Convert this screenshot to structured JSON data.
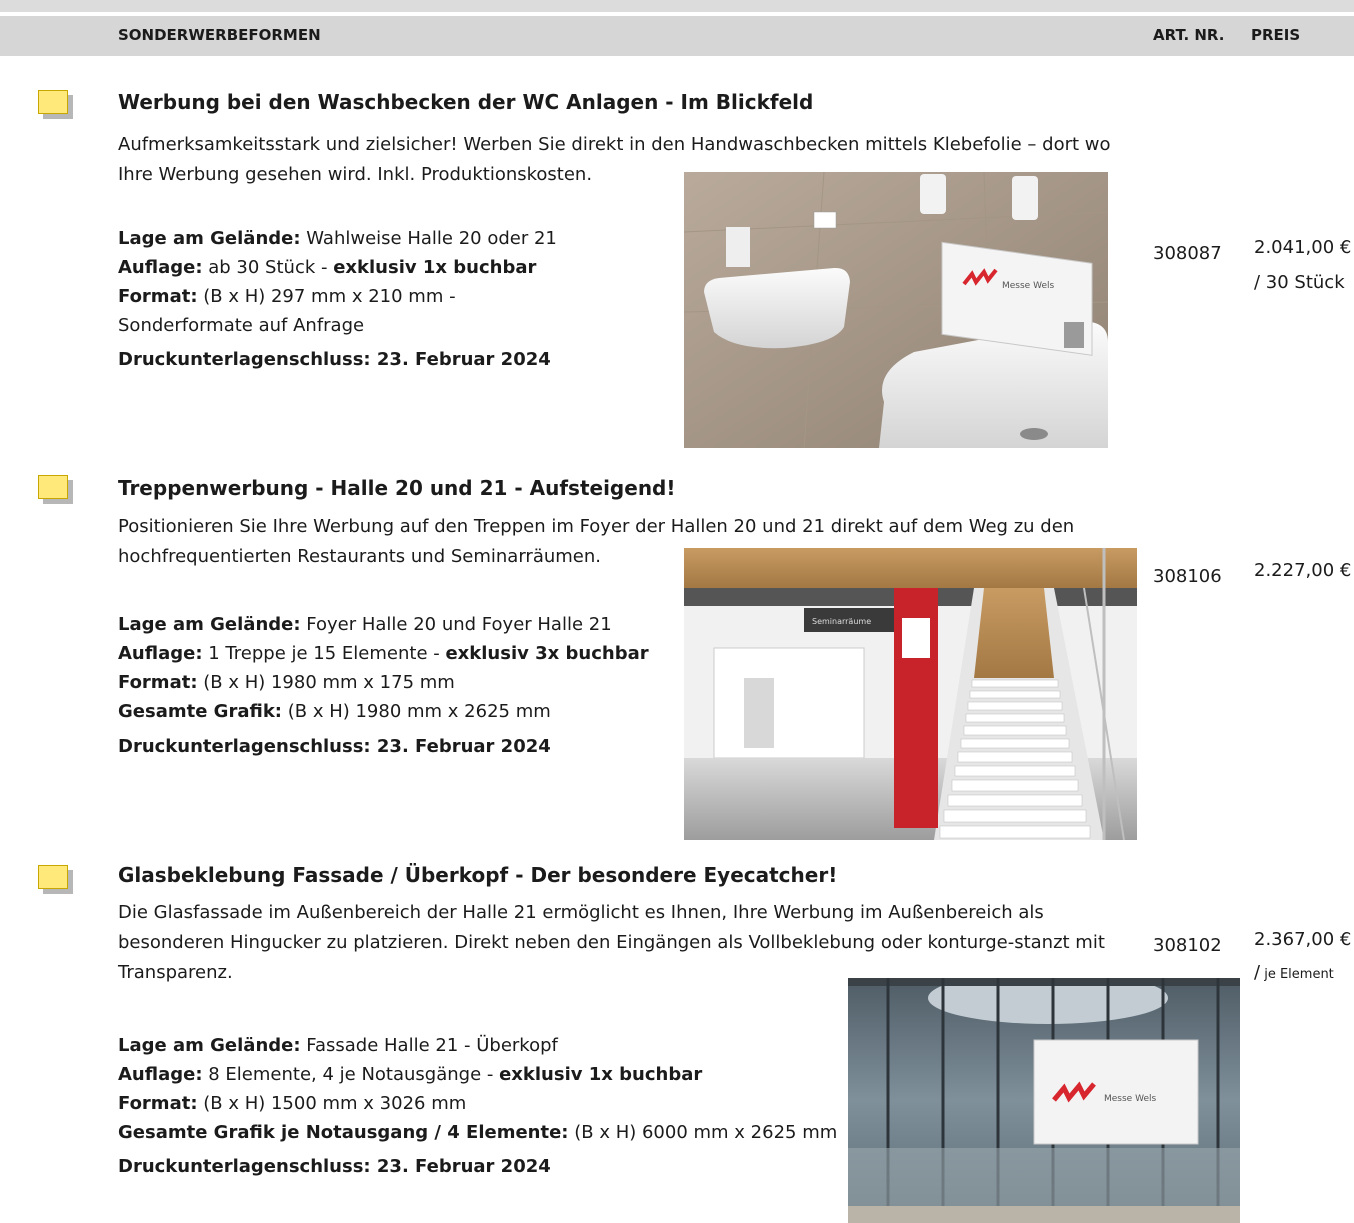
{
  "header": {
    "section": "SONDERWERBEFORMEN",
    "art_nr": "ART. NR.",
    "preis": "PREIS"
  },
  "items": [
    {
      "title": "Werbung bei den Waschbecken der WC Anlagen - Im Blickfeld",
      "desc": "Aufmerksamkeitsstark und zielsicher! Werben Sie direkt in den Handwaschbecken mittels Klebefolie – dort wo Ihre Werbung gesehen wird. Inkl. Produktionskosten.",
      "lage_label": "Lage am Gelände:",
      "lage": " Wahlweise Halle 20 oder 21",
      "auflage_label": "Auflage:",
      "auflage": " ab 30 Stück - ",
      "auflage_bold": "exklusiv 1x buchbar",
      "format_label": "Format:",
      "format": " (B x H) 297 mm x 210 mm -",
      "format2": "Sonderformate auf Anfrage",
      "deadline": "Druckunterlagenschluss: 23. Februar 2024",
      "art_nr": "308087",
      "price": "2.041,00 €",
      "unit": "/ 30 Stück",
      "image_text": "Messe Wels"
    },
    {
      "title": "Treppenwerbung - Halle 20 und 21 - Aufsteigend!",
      "desc": "Positionieren Sie Ihre Werbung auf den Treppen im Foyer der Hallen 20 und 21 direkt auf dem Weg zu den hochfrequentierten Restaurants und Seminarräumen.",
      "lage_label": "Lage am Gelände:",
      "lage": " Foyer Halle 20 und Foyer Halle 21",
      "auflage_label": "Auflage:",
      "auflage": " 1 Treppe je 15 Elemente - ",
      "auflage_bold": "exklusiv 3x buchbar",
      "format_label": "Format:",
      "format": " (B x H) 1980 mm x 175 mm",
      "grafik_label": "Gesamte Grafik:",
      "grafik": " (B x H) 1980 mm x 2625 mm",
      "deadline": "Druckunterlagenschluss: 23. Februar 2024",
      "art_nr": "308106",
      "price": "2.227,00 €",
      "image_text": "Seminarräume"
    },
    {
      "title": "Glasbeklebung Fassade / Überkopf - Der besondere Eyecatcher!",
      "desc": "Die Glasfassade im Außenbereich der Halle 21 ermöglicht es Ihnen, Ihre Werbung im Außenbereich als besonderen Hingucker zu platzieren. Direkt neben den Eingängen als Vollbeklebung oder konturge-stanzt mit Transparenz.",
      "lage_label": "Lage am Gelände:",
      "lage": " Fassade Halle 21 - Überkopf",
      "auflage_label": "Auflage:",
      "auflage": " 8 Elemente, 4 je Notausgänge - ",
      "auflage_bold": "exklusiv 1x buchbar",
      "format_label": "Format:",
      "format": " (B x H) 1500 mm x 3026 mm",
      "grafik_label": "Gesamte Grafik je Notausgang / 4 Elemente:",
      "grafik": " (B x H) 6000 mm x 2625 mm",
      "deadline": "Druckunterlagenschluss: 23. Februar 2024",
      "art_nr": "308102",
      "price": "2.367,00 €",
      "unit_slash": "/",
      "unit_small": " je Element",
      "image_text": "Messe Wels"
    }
  ],
  "colors": {
    "checkbox_fill": "#ffe97a",
    "header_bar": "#d6d6d6",
    "brand_red": "#d8262e"
  }
}
